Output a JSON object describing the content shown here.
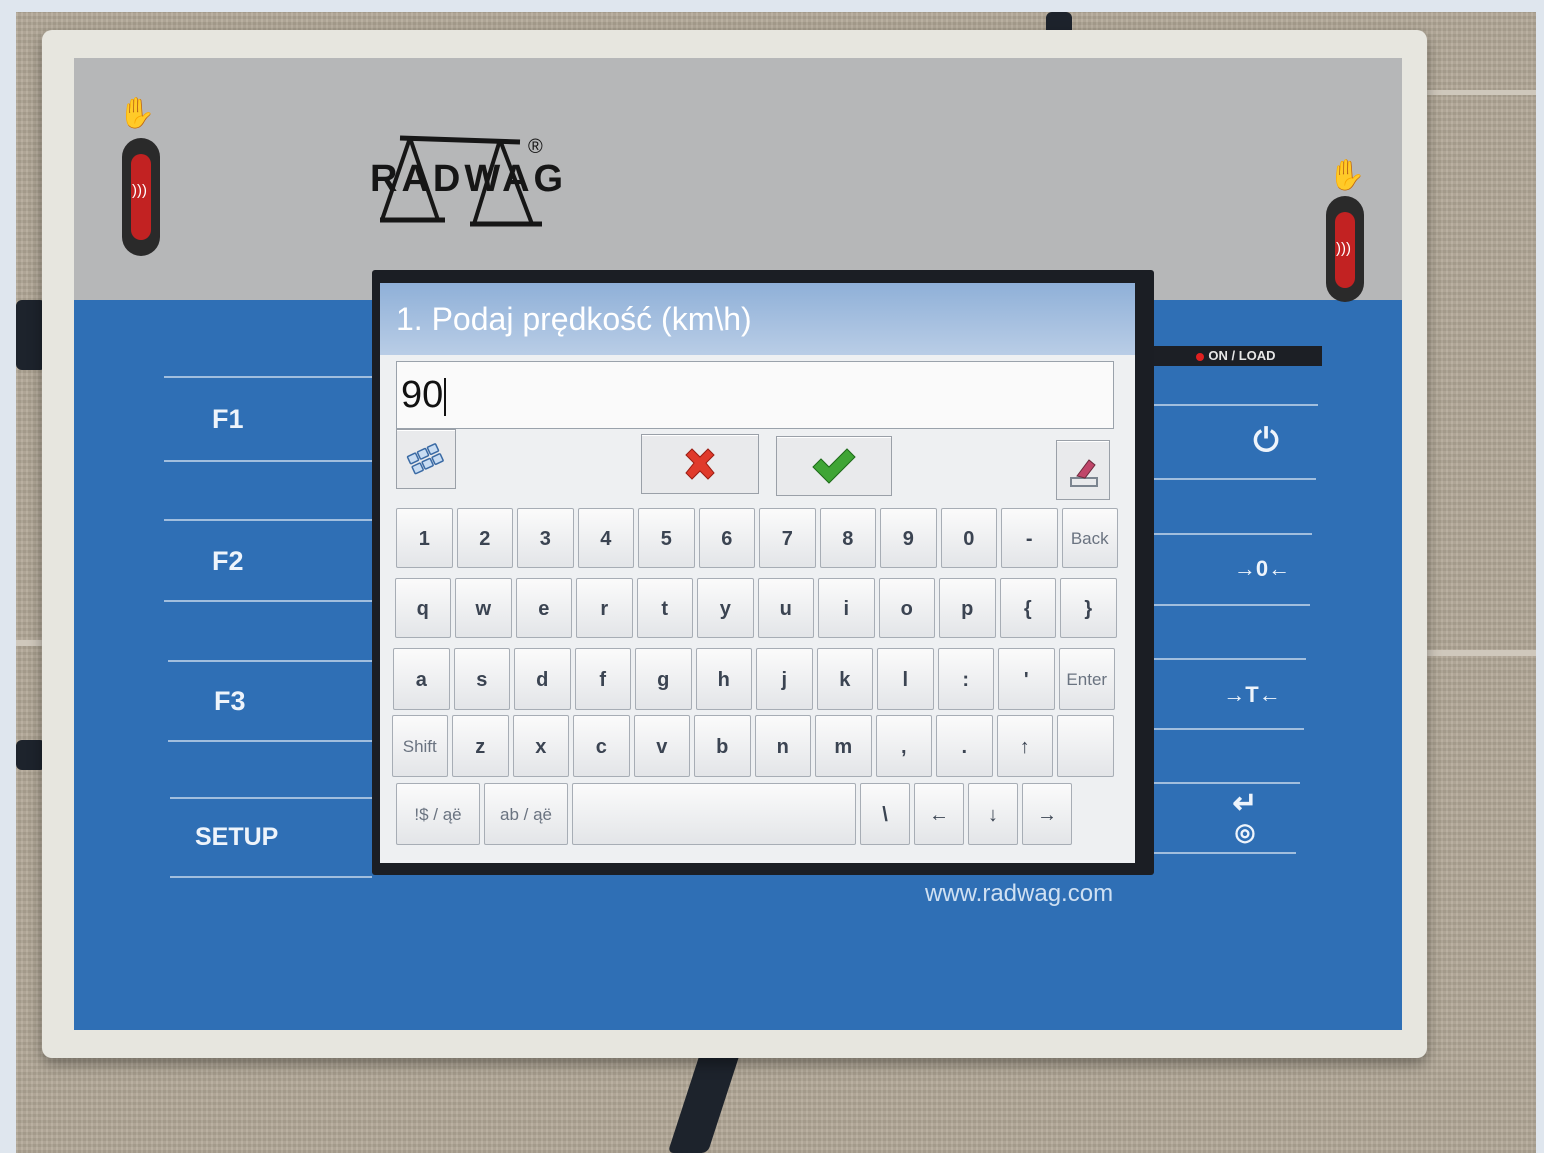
{
  "dialog": {
    "title": "1. Podaj prędkość (km\\h)",
    "input_value": "90",
    "cancel_icon": "red-x-icon",
    "confirm_icon": "green-check-icon",
    "keyboard_icon": "keyboard-icon",
    "clear_icon": "eraser-icon"
  },
  "keyboard": {
    "row1": [
      "1",
      "2",
      "3",
      "4",
      "5",
      "6",
      "7",
      "8",
      "9",
      "0",
      "-",
      "Back"
    ],
    "row2": [
      "q",
      "w",
      "e",
      "r",
      "t",
      "y",
      "u",
      "i",
      "o",
      "p",
      "{",
      "}"
    ],
    "row3": [
      "a",
      "s",
      "d",
      "f",
      "g",
      "h",
      "j",
      "k",
      "l",
      ":",
      "'",
      "Enter"
    ],
    "row4": [
      "Shift",
      "z",
      "x",
      "c",
      "v",
      "b",
      "n",
      "m",
      ",",
      ".",
      "↑",
      ""
    ],
    "row5": [
      "!$ / ąë",
      "ab / ąë",
      "",
      "\\",
      "←",
      "↓",
      "→"
    ]
  },
  "device": {
    "brand": "RADWAG",
    "registered": "®",
    "url": "www.radwag.com",
    "onload_label": "ON / LOAD",
    "left_keys": [
      "F1",
      "F2",
      "F3",
      "SETUP"
    ],
    "right_keys": {
      "power": "⏻",
      "zero": "→0←",
      "tare": "→T←",
      "enter": "↵",
      "print": "◎"
    }
  },
  "colors": {
    "panel_blue": "#2f6fb5",
    "title_blue": "#8fb0d8",
    "cancel_red": "#e03a2b",
    "confirm_green": "#3fa535"
  }
}
